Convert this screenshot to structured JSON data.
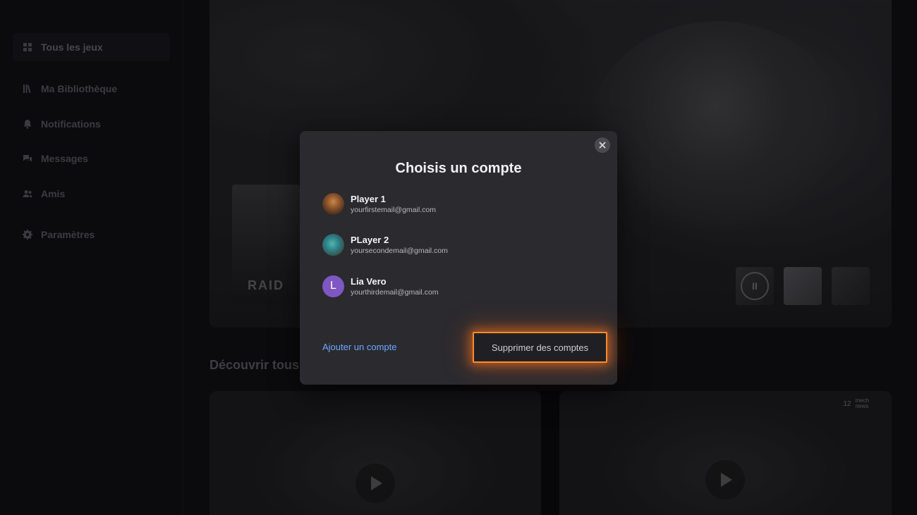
{
  "sidebar": {
    "items": [
      {
        "label": "Tous les jeux",
        "icon": "grid-icon",
        "active": true
      },
      {
        "label": "Ma Bibliothèque",
        "icon": "library-icon",
        "active": false
      },
      {
        "label": "Notifications",
        "icon": "bell-icon",
        "active": false
      },
      {
        "label": "Messages",
        "icon": "chat-icon",
        "active": false
      },
      {
        "label": "Amis",
        "icon": "friends-icon",
        "active": false
      },
      {
        "label": "Paramètres",
        "icon": "gear-icon",
        "active": false
      }
    ]
  },
  "main": {
    "hero_card_title": "RAID",
    "discover_title": "Découvrir tous",
    "news_badge": {
      "number": "12",
      "brand_line1": "mech",
      "brand_line2": "news"
    }
  },
  "modal": {
    "title": "Choisis un compte",
    "accounts": [
      {
        "name": "Player 1",
        "email": "yourfirstemail@gmail.com",
        "avatar": "player1-avatar"
      },
      {
        "name": "PLayer 2",
        "email": "yoursecondemail@gmail.com",
        "avatar": "player2-avatar"
      },
      {
        "name": "Lia Vero",
        "email": "yourthirdemail@gmail.com",
        "avatar_letter": "L",
        "avatar_color": "#7e57c2"
      }
    ],
    "add_account_label": "Ajouter un compte",
    "remove_accounts_label": "Supprimer des comptes",
    "highlight_color": "#ff8a2a",
    "link_color": "#6ea8ff"
  }
}
